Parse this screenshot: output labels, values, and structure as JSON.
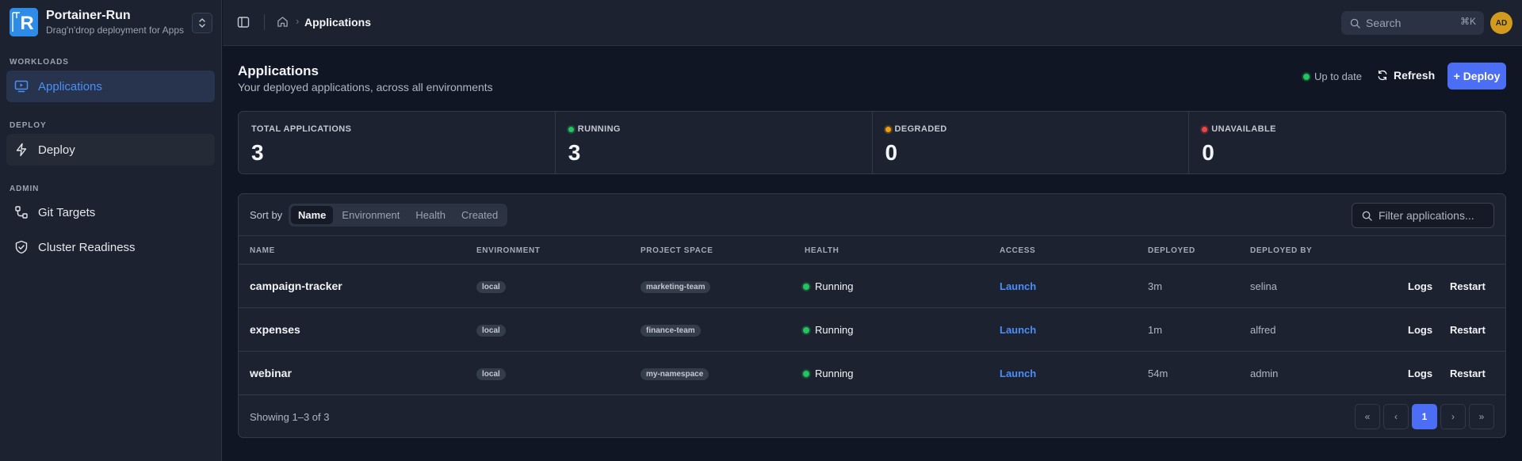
{
  "brand": {
    "title": "Portainer-Run",
    "subtitle": "Drag'n'drop deployment for Apps",
    "logo_letter": "R"
  },
  "sidebar": {
    "sections": [
      {
        "label": "WORKLOADS"
      },
      {
        "label": "DEPLOY"
      },
      {
        "label": "ADMIN"
      }
    ],
    "items": [
      {
        "label": "Applications",
        "icon": "monitor-play-icon",
        "active": true
      },
      {
        "label": "Deploy",
        "icon": "lightning-icon"
      },
      {
        "label": "Git Targets",
        "icon": "git-branch-icon"
      },
      {
        "label": "Cluster Readiness",
        "icon": "shield-check-icon"
      }
    ]
  },
  "topbar": {
    "breadcrumb": "Applications",
    "breadcrumb_sep": "›",
    "search_placeholder": "Search",
    "search_shortcut": "⌘K",
    "avatar": "AD"
  },
  "header": {
    "title": "Applications",
    "subtitle": "Your deployed applications, across all environments",
    "status": "Up to date",
    "refresh_label": "Refresh",
    "deploy_label": "+ Deploy"
  },
  "stats": [
    {
      "label": "TOTAL APPLICATIONS",
      "value": "3",
      "dot": ""
    },
    {
      "label": "RUNNING",
      "value": "3",
      "dot": "green"
    },
    {
      "label": "DEGRADED",
      "value": "0",
      "dot": "amber"
    },
    {
      "label": "UNAVAILABLE",
      "value": "0",
      "dot": "red"
    }
  ],
  "table": {
    "sort_label": "Sort by",
    "sort_options": [
      "Name",
      "Environment",
      "Health",
      "Created"
    ],
    "sort_active": "Name",
    "filter_placeholder": "Filter applications...",
    "columns": [
      "NAME",
      "ENVIRONMENT",
      "PROJECT SPACE",
      "HEALTH",
      "ACCESS",
      "DEPLOYED",
      "DEPLOYED BY"
    ],
    "rows": [
      {
        "name": "campaign-tracker",
        "environment": "local",
        "project_space": "marketing-team",
        "health": "Running",
        "access": "Launch",
        "deployed": "3m",
        "deployed_by": "selina",
        "logs": "Logs",
        "restart": "Restart"
      },
      {
        "name": "expenses",
        "environment": "local",
        "project_space": "finance-team",
        "health": "Running",
        "access": "Launch",
        "deployed": "1m",
        "deployed_by": "alfred",
        "logs": "Logs",
        "restart": "Restart"
      },
      {
        "name": "webinar",
        "environment": "local",
        "project_space": "my-namespace",
        "health": "Running",
        "access": "Launch",
        "deployed": "54m",
        "deployed_by": "admin",
        "logs": "Logs",
        "restart": "Restart"
      }
    ],
    "showing": "Showing 1–3 of 3",
    "pager": {
      "first": "«",
      "prev": "‹",
      "current": "1",
      "next": "›",
      "last": "»"
    }
  },
  "colors": {
    "accent": "#4c6ef5",
    "link": "#4a8ff7",
    "running": "#22c55e",
    "degraded": "#f59e0b",
    "unavailable": "#ef4444",
    "avatar": "#d39b1c"
  }
}
